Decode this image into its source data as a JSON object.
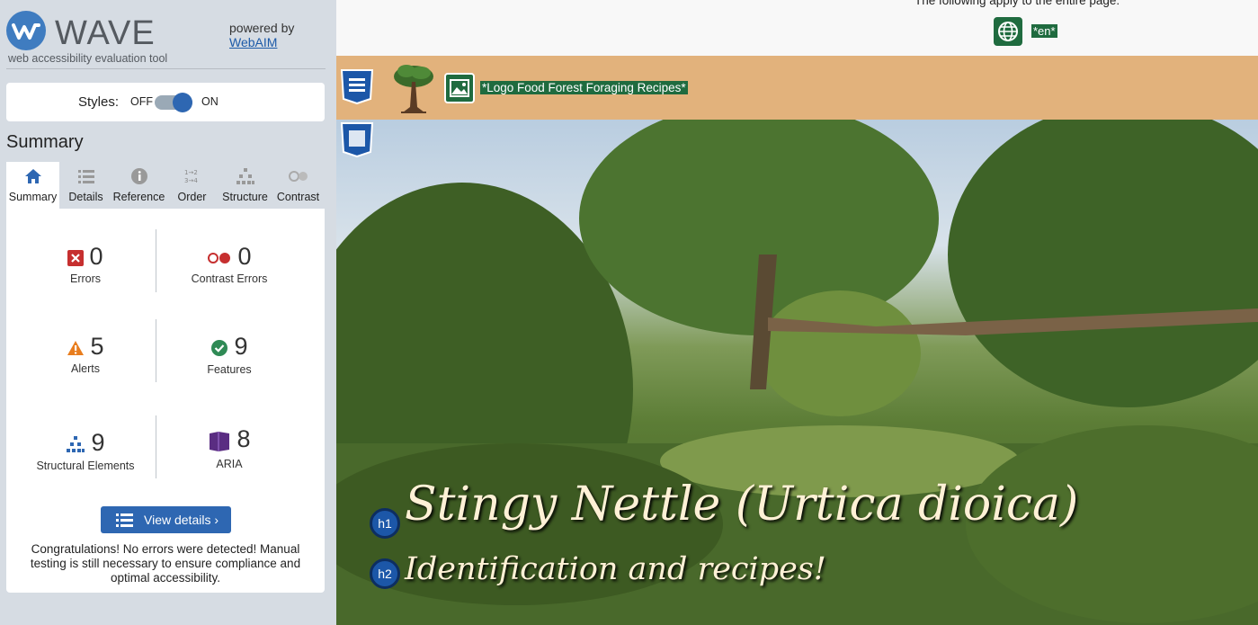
{
  "wave": {
    "logo_text": "WAVE",
    "logo_subtitle": "web accessibility evaluation tool",
    "powered_by": "powered by",
    "powered_link": "WebAIM",
    "styles_label": "Styles:",
    "styles_off": "OFF",
    "styles_on": "ON",
    "styles_enabled": true,
    "summary_heading": "Summary",
    "tabs": [
      {
        "label": "Summary",
        "icon": "home-icon",
        "active": true
      },
      {
        "label": "Details",
        "icon": "list-icon",
        "active": false
      },
      {
        "label": "Reference",
        "icon": "info-icon",
        "active": false
      },
      {
        "label": "Order",
        "icon": "order-icon",
        "active": false
      },
      {
        "label": "Structure",
        "icon": "structure-icon",
        "active": false
      },
      {
        "label": "Contrast",
        "icon": "contrast-icon",
        "active": false
      }
    ],
    "stats": {
      "errors": {
        "count": "0",
        "label": "Errors"
      },
      "contrast_errors": {
        "count": "0",
        "label": "Contrast Errors"
      },
      "alerts": {
        "count": "5",
        "label": "Alerts"
      },
      "features": {
        "count": "9",
        "label": "Features"
      },
      "structural": {
        "count": "9",
        "label": "Structural Elements"
      },
      "aria": {
        "count": "8",
        "label": "ARIA"
      }
    },
    "view_details": "View details ›",
    "congrats": "Congratulations! No errors were detected! Manual testing is still necessary to ensure compliance and optimal accessibility."
  },
  "preview": {
    "apply_text": "The following apply to the entire page:",
    "lang_tag": "*en*",
    "logo_alt": "*Logo Food Forest Foraging Recipes*",
    "h1_badge": "h1",
    "h1_text": "Stingy Nettle (Urtica dioica)",
    "h2_badge": "h2",
    "h2_text": "Identification and recipes!"
  },
  "colors": {
    "wave_blue": "#2e67b2",
    "sidebar_bg": "#d6dce3",
    "header_tan": "#e2b27c",
    "feature_green": "#1f6b3f",
    "error_red": "#c62f2f",
    "alert_orange": "#e87d1e",
    "aria_purple": "#5a2d82"
  }
}
